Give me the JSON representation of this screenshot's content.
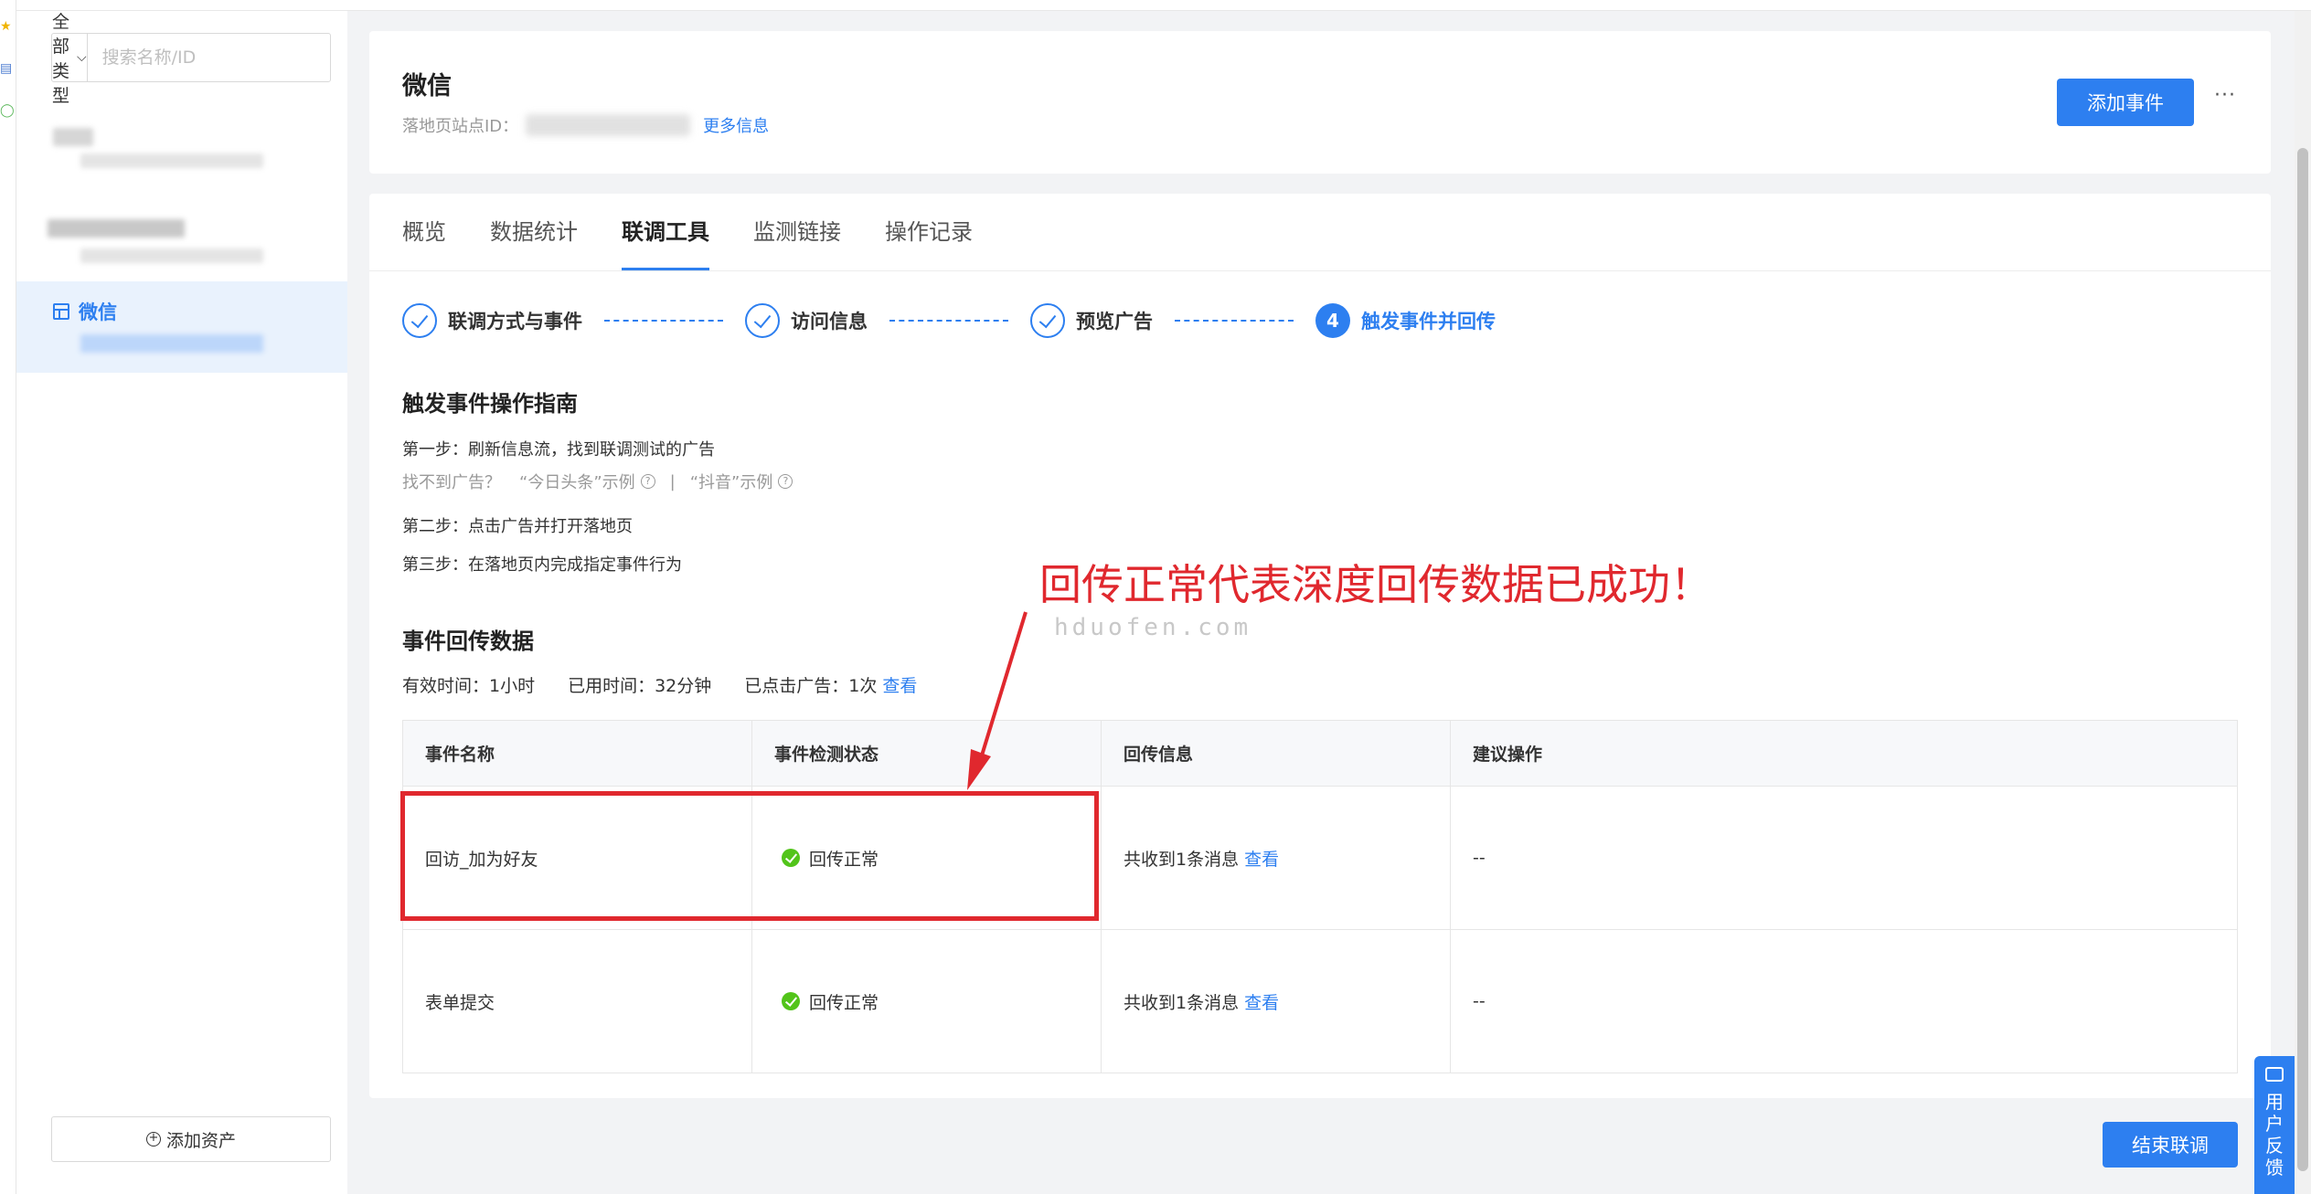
{
  "sidebar": {
    "type_select": "全部类型",
    "search_placeholder": "搜索名称/ID",
    "active_asset": "微信",
    "add_asset": "添加资产"
  },
  "header": {
    "title": "微信",
    "site_id_label": "落地页站点ID：",
    "more_info": "更多信息",
    "add_event": "添加事件",
    "more": "···"
  },
  "tabs": [
    "概览",
    "数据统计",
    "联调工具",
    "监测链接",
    "操作记录"
  ],
  "steps": [
    {
      "label": "联调方式与事件"
    },
    {
      "label": "访问信息"
    },
    {
      "label": "预览广告"
    },
    {
      "num": "4",
      "label": "触发事件并回传"
    }
  ],
  "guide": {
    "title": "触发事件操作指南",
    "step1": "第一步：刷新信息流，找到联调测试的广告",
    "hint_prefix": "找不到广告？",
    "hint_toutiao": "“今日头条”示例",
    "hint_sep": "|",
    "hint_douyin": "“抖音”示例",
    "step2": "第二步：点击广告并打开落地页",
    "step3": "第三步：在落地页内完成指定事件行为"
  },
  "events": {
    "title": "事件回传数据",
    "valid_time": "有效时间：1小时",
    "used_time": "已用时间：32分钟",
    "clicked": "已点击广告：1次",
    "view": "查看",
    "headers": [
      "事件名称",
      "事件检测状态",
      "回传信息",
      "建议操作"
    ],
    "rows": [
      {
        "name": "回访_加为好友",
        "status": "回传正常",
        "info": "共收到1条消息",
        "view": "查看",
        "action": "--"
      },
      {
        "name": "表单提交",
        "status": "回传正常",
        "info": "共收到1条消息",
        "view": "查看",
        "action": "--"
      }
    ]
  },
  "end_debug": "结束联调",
  "annotation": "回传正常代表深度回传数据已成功！",
  "watermark": "hduofen.com",
  "feedback": "用户反馈",
  "colors": {
    "primary": "#2d7ff0",
    "success": "#52c41a",
    "annotation": "#e0282e"
  }
}
